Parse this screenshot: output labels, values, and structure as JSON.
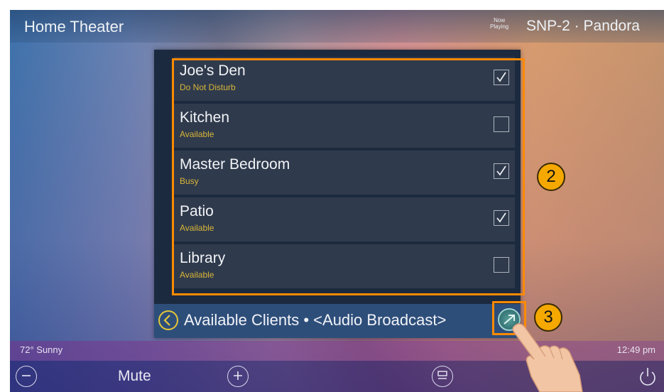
{
  "header": {
    "title": "Home Theater",
    "now_playing": "Now Playing",
    "source": "SNP-2 · Pandora"
  },
  "clients": [
    {
      "name": "Joe's Den",
      "status": "Do Not Disturb",
      "checked": true
    },
    {
      "name": "Kitchen",
      "status": "Available",
      "checked": false
    },
    {
      "name": "Master Bedroom",
      "status": "Busy",
      "checked": true
    },
    {
      "name": "Patio",
      "status": "Available",
      "checked": true
    },
    {
      "name": "Library",
      "status": "Available",
      "checked": false
    }
  ],
  "footer": {
    "text": "Available Clients • <Audio Broadcast>"
  },
  "status_bar": {
    "weather": "72° Sunny",
    "time": "12:49 pm"
  },
  "bottom_bar": {
    "mute_label": "Mute"
  },
  "callouts": [
    "2",
    "3"
  ],
  "colors": {
    "highlight": "#ff8a00",
    "callout_fill": "#f5a800",
    "status_text": "#d9b638"
  }
}
